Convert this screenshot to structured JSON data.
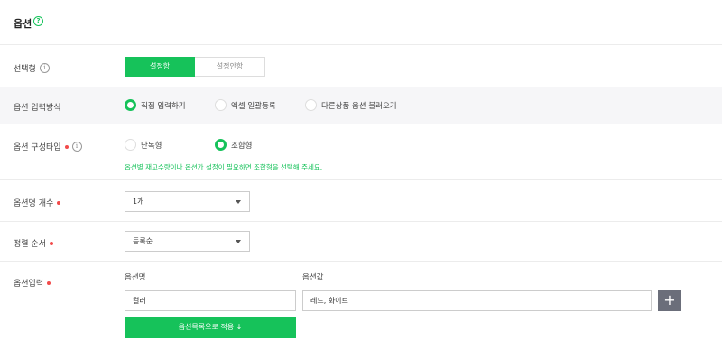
{
  "header": {
    "title": "옵션",
    "help_icon": "question-circle-icon"
  },
  "option_type": {
    "label": "선택형",
    "options": [
      "설정함",
      "설정안함"
    ],
    "selected": "설정함"
  },
  "input_method": {
    "label": "옵션 입력방식",
    "options": [
      "직접 입력하기",
      "엑셀 일괄등록",
      "다른상품 옵션 불러오기"
    ],
    "selected": "직접 입력하기"
  },
  "composition_type": {
    "label": "옵션 구성타입",
    "options": [
      "단독형",
      "조합형"
    ],
    "selected": "조합형",
    "hint": "옵션별 재고수량이나 옵션가 설정이 필요하면 조합형을 선택해 주세요."
  },
  "option_count": {
    "label": "옵션명 개수",
    "value": "1개"
  },
  "sort_order": {
    "label": "정렬 순서",
    "value": "등록순"
  },
  "option_input": {
    "label": "옵션입력",
    "name_header": "옵션명",
    "value_header": "옵션값",
    "name_value": "컬러",
    "values_value": "레드, 화이트",
    "add_icon": "plus-icon",
    "apply_label": "옵션목록으로 적용 ↓"
  },
  "colors": {
    "accent": "#16c25a",
    "required_dot": "#f24b4b",
    "plus_button": "#6b6e7a"
  }
}
